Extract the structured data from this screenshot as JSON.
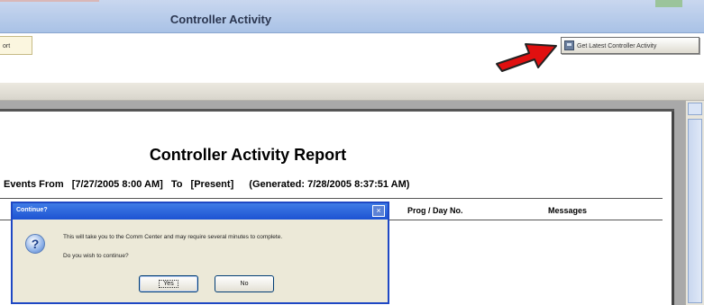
{
  "window": {
    "title": "Controller Activity"
  },
  "toolbar": {
    "left_button_label": "ort",
    "get_latest_label": "Get Latest Controller Activity",
    "get_latest_icon": "controller-icon",
    "callout": "red-arrow"
  },
  "report": {
    "title": "Controller Activity Report",
    "range_prefix": "Events From",
    "range_from": "[7/27/2005 8:00 AM]",
    "range_to_label": "To",
    "range_to": "[Present]",
    "generated": "(Generated: 7/28/2005 8:37:51 AM)",
    "columns": [
      "Prog / Day No.",
      "Messages"
    ]
  },
  "dialog": {
    "title": "Continue?",
    "close_glyph": "×",
    "icon": "question-icon",
    "message": "This will take you to the Comm Center and may require several minutes to complete.",
    "question": "Do you wish to continue?",
    "yes_label": "Yes",
    "no_label": "No"
  },
  "colors": {
    "titlebar": "#b4c8ea",
    "dialog_titlebar": "#2a5fd8",
    "callout_arrow": "#e01010"
  }
}
